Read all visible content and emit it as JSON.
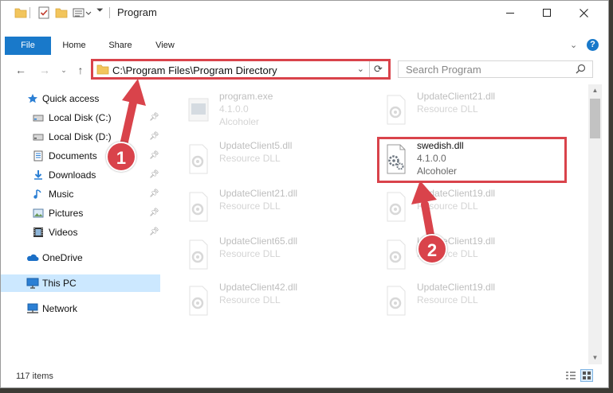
{
  "window": {
    "title": "Program",
    "controls": {
      "minimize": "minimize-icon",
      "maximize": "maximize-icon",
      "close": "close-icon"
    }
  },
  "ribbon": {
    "tabs": [
      "File",
      "Home",
      "Share",
      "View"
    ]
  },
  "address": {
    "path": "C:\\Program Files\\Program Directory"
  },
  "search": {
    "placeholder": "Search Program"
  },
  "nav": {
    "items": [
      {
        "label": "Quick access",
        "icon": "star-icon"
      },
      {
        "label": "Local Disk (C:)",
        "icon": "drive-icon",
        "pinned": true
      },
      {
        "label": "Local Disk (D:)",
        "icon": "drive-icon",
        "pinned": true
      },
      {
        "label": "Documents",
        "icon": "documents-icon",
        "pinned": true
      },
      {
        "label": "Downloads",
        "icon": "downloads-icon",
        "pinned": true
      },
      {
        "label": "Music",
        "icon": "music-icon",
        "pinned": true
      },
      {
        "label": "Pictures",
        "icon": "pictures-icon",
        "pinned": true
      },
      {
        "label": "Videos",
        "icon": "videos-icon",
        "pinned": true
      },
      {
        "label": "OneDrive",
        "icon": "onedrive-icon"
      },
      {
        "label": "This PC",
        "icon": "computer-icon",
        "selected": true
      },
      {
        "label": "Network",
        "icon": "network-icon"
      }
    ]
  },
  "files": [
    {
      "name": "program.exe",
      "line2": "4.1.0.0",
      "line3": "Alcoholer",
      "faded": true
    },
    {
      "name": "UpdateClient21.dll",
      "line2": "Resource DLL",
      "faded": true
    },
    {
      "name": "UpdateClient5.dll",
      "line2": "Resource DLL",
      "faded": true
    },
    {
      "name": "swedish.dll",
      "line2": "4.1.0.0",
      "line3": "Alcoholer",
      "faded": false
    },
    {
      "name": "UpdateClient21.dll",
      "line2": "Resource DLL",
      "faded": true
    },
    {
      "name": "UpdateClient19.dll",
      "line2": "Resource DLL",
      "faded": true
    },
    {
      "name": "UpdateClient65.dll",
      "line2": "Resource DLL",
      "faded": true
    },
    {
      "name": "UpdateClient19.dll",
      "line2": "Resource DLL",
      "faded": true
    },
    {
      "name": "UpdateClient42.dll",
      "line2": "Resource DLL",
      "faded": true
    },
    {
      "name": "UpdateClient19.dll",
      "line2": "Resource DLL",
      "faded": true
    }
  ],
  "status": {
    "item_count": "117 items"
  },
  "annotations": {
    "step1": "1",
    "step2": "2",
    "color": "#d9434b"
  }
}
